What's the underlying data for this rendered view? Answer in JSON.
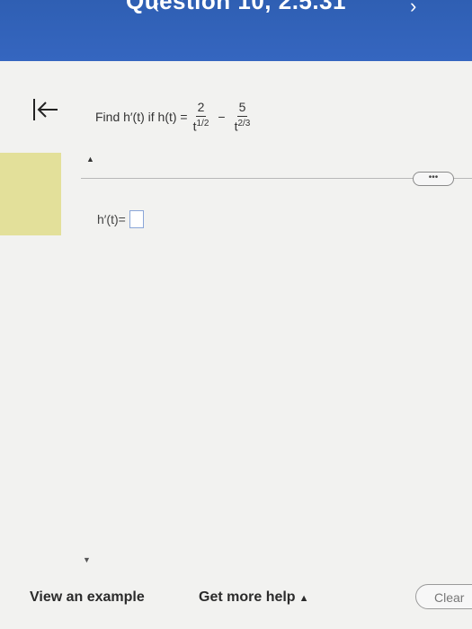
{
  "header": {
    "title": "Question 10, 2.5.31",
    "prev_icon": "chevron-left-icon",
    "next_icon": "chevron-right-icon",
    "accent_color": "#3566c0"
  },
  "toolbar": {
    "first_icon": "skip-to-first-icon"
  },
  "question": {
    "prefix": "Find h′(t)  if  h(t) =",
    "term1_numerator": "2",
    "term1_base": "t",
    "term1_exponent": "1/2",
    "operator": "−",
    "term2_numerator": "5",
    "term2_base": "t",
    "term2_exponent": "2/3"
  },
  "more_button": {
    "label": "•••"
  },
  "answer": {
    "label": "h′(t)=",
    "value": ""
  },
  "footer": {
    "view_example": "View an example",
    "get_more_help": "Get more help",
    "help_caret": "▲",
    "clear": "Clear"
  }
}
